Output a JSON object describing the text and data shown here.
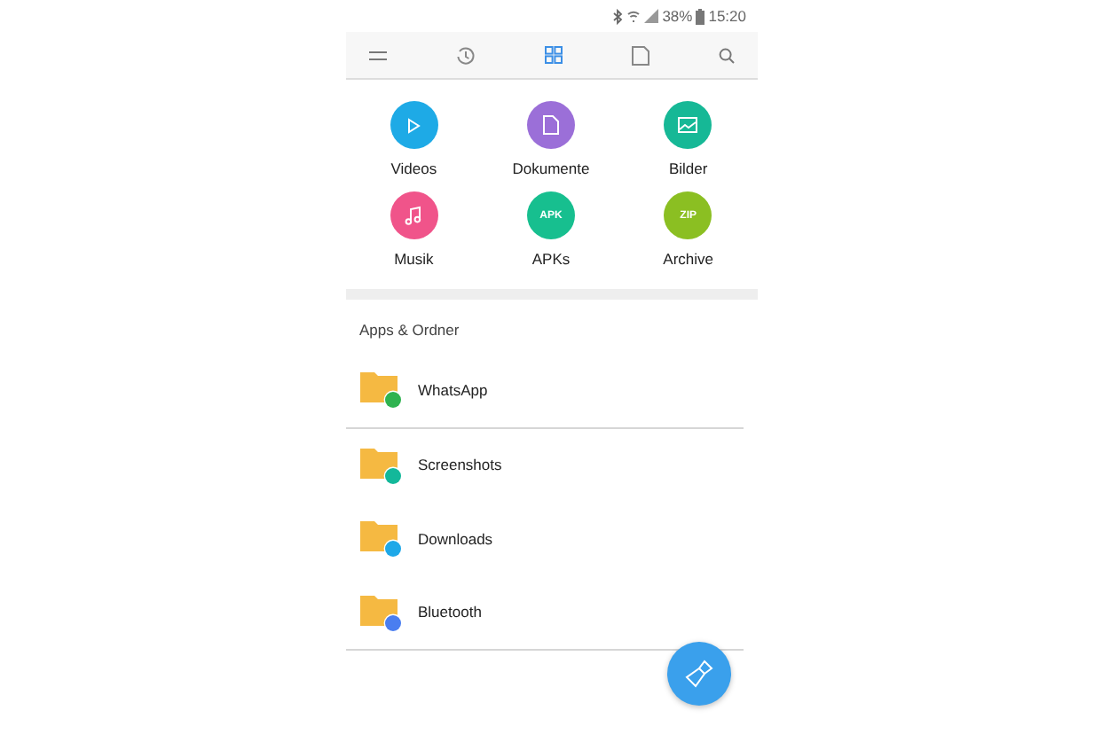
{
  "status_bar": {
    "battery": "38%",
    "time": "15:20"
  },
  "toolbar": {
    "tabs": [
      {
        "kind": "recent",
        "selected": false
      },
      {
        "kind": "categories",
        "selected": true
      },
      {
        "kind": "storage",
        "selected": false
      }
    ]
  },
  "categories": [
    {
      "label": "Videos",
      "color": "#1eaae6",
      "kind": "play"
    },
    {
      "label": "Dokumente",
      "color": "#9b6fd8",
      "kind": "document"
    },
    {
      "label": "Bilder",
      "color": "#16b896",
      "kind": "image"
    },
    {
      "label": "Musik",
      "color": "#f0548a",
      "kind": "music"
    },
    {
      "label": "APKs",
      "color": "#17bf8f",
      "kind": "text",
      "glyph": "APK"
    },
    {
      "label": "Archive",
      "color": "#8bbf22",
      "kind": "text",
      "glyph": "ZIP"
    }
  ],
  "section_title": "Apps & Ordner",
  "folders": [
    {
      "name": "WhatsApp",
      "color": "#2fb350",
      "divider": true
    },
    {
      "name": "Screenshots",
      "color": "#13b89a",
      "divider": false
    },
    {
      "name": "Downloads",
      "color": "#1ea8e8",
      "divider": false
    },
    {
      "name": "Bluetooth",
      "color": "#4a7ef0",
      "divider": true
    }
  ]
}
